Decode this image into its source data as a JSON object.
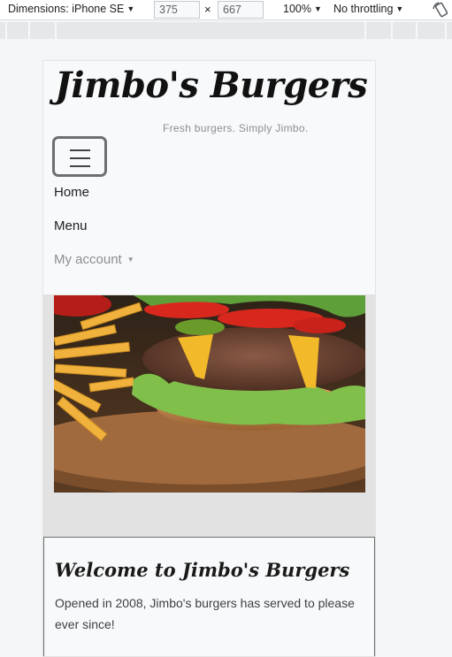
{
  "devtools": {
    "dimensions_label": "Dimensions: iPhone SE",
    "width_value": "375",
    "height_value": "667",
    "times_symbol": "×",
    "zoom": "100%",
    "throttling": "No throttling"
  },
  "site": {
    "brand": "Jimbo's Burgers",
    "tagline": "Fresh burgers. Simply Jimbo.",
    "nav": {
      "home": "Home",
      "menu": "Menu",
      "account": "My account"
    },
    "card": {
      "title": "Welcome to Jimbo's Burgers",
      "text": "Opened in 2008, Jimbo's burgers has served to please ever since!"
    }
  },
  "colors": {
    "header_bg": "#f8f9fa",
    "text": "#202124",
    "muted": "#8a8f94"
  }
}
